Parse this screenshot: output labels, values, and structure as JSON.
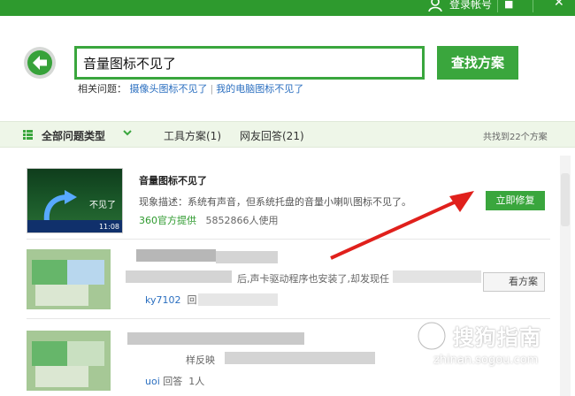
{
  "topbar": {
    "login_label": "登录帐号"
  },
  "search": {
    "value": "音量图标不见了",
    "button_label": "查找方案",
    "related_label": "相关问题：",
    "related_links": [
      "摄像头图标不见了",
      "我的电脑图标不见了"
    ]
  },
  "filter": {
    "all_label": "全部问题类型",
    "tab_tools": "工具方案(1)",
    "tab_answers": "网友回答(21)",
    "found_text": "共找到22个方案"
  },
  "result1": {
    "title": "音量图标不见了",
    "description": "现象描述：系统有声音，但系统托盘的音量小喇叭图标不见了。",
    "provider": "360官方提供",
    "users": "5852866人使用",
    "fix_label": "立即修复",
    "thumb_text": "不见了",
    "thumb_time": "11:08"
  },
  "result2": {
    "fragment": "后,声卡驱动程序也安装了,却发现任",
    "user": "ky7102",
    "answer_frag": "回",
    "button_frag": "看方案"
  },
  "result3": {
    "fragment": "样反映",
    "user": "uoi",
    "answer_label": "回答",
    "count_frag": "1人"
  },
  "watermark": {
    "brand": "搜狗指南",
    "url": "zhinan.sogou.com"
  },
  "colors": {
    "brand_green": "#3aa63d",
    "topbar_green": "#2e9a2e",
    "link_blue": "#2b6fc0",
    "arrow_red": "#e0201c"
  }
}
